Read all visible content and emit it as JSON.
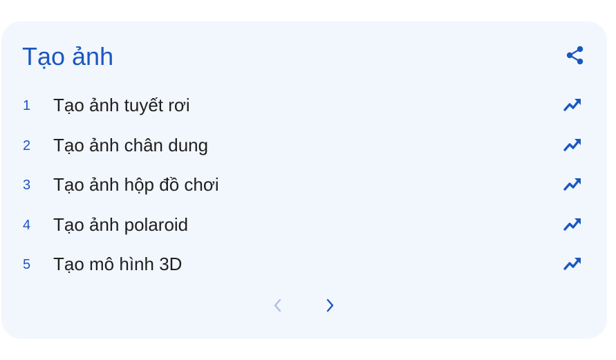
{
  "card": {
    "title": "Tạo ảnh",
    "share_icon": "share-icon",
    "accent_color": "#1a57bf",
    "background_color": "#f2f6fd"
  },
  "items": [
    {
      "rank": "1",
      "label": "Tạo ảnh tuyết rơi",
      "icon": "trending-up-icon"
    },
    {
      "rank": "2",
      "label": "Tạo ảnh chân dung",
      "icon": "trending-up-icon"
    },
    {
      "rank": "3",
      "label": "Tạo ảnh hộp đồ chơi",
      "icon": "trending-up-icon"
    },
    {
      "rank": "4",
      "label": "Tạo ảnh polaroid",
      "icon": "trending-up-icon"
    },
    {
      "rank": "5",
      "label": "Tạo mô hình 3D",
      "icon": "trending-up-icon"
    }
  ],
  "pagination": {
    "prev_icon": "chevron-left-icon",
    "prev_enabled": false,
    "next_icon": "chevron-right-icon",
    "next_enabled": true
  }
}
